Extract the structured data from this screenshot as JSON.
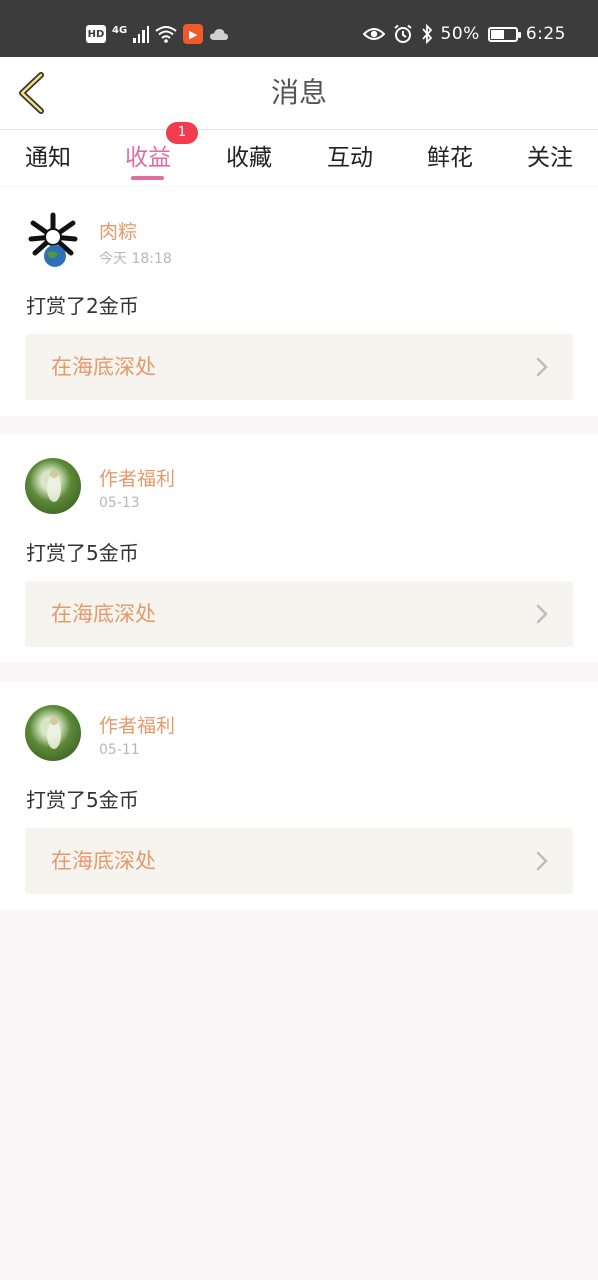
{
  "status_bar": {
    "hd": "HD",
    "network": "4G",
    "battery_percent": "50%",
    "time": "6:25"
  },
  "header": {
    "title": "消息"
  },
  "tabs": [
    {
      "label": "通知"
    },
    {
      "label": "收益",
      "active": true,
      "badge": "1"
    },
    {
      "label": "收藏"
    },
    {
      "label": "互动"
    },
    {
      "label": "鲜花"
    },
    {
      "label": "关注"
    }
  ],
  "messages": [
    {
      "author": "肉粽",
      "time": "今天 18:18",
      "text": "打赏了2金币",
      "link": "在海底深处"
    },
    {
      "author": "作者福利",
      "time": "05-13",
      "text": "打赏了5金币",
      "link": "在海底深处"
    },
    {
      "author": "作者福利",
      "time": "05-11",
      "text": "打赏了5金币",
      "link": "在海底深处"
    }
  ],
  "colors": {
    "accent": "#e06ca0",
    "author": "#e59a6b",
    "badge": "#f03c4d",
    "status_bar": "#3c3c3c"
  }
}
